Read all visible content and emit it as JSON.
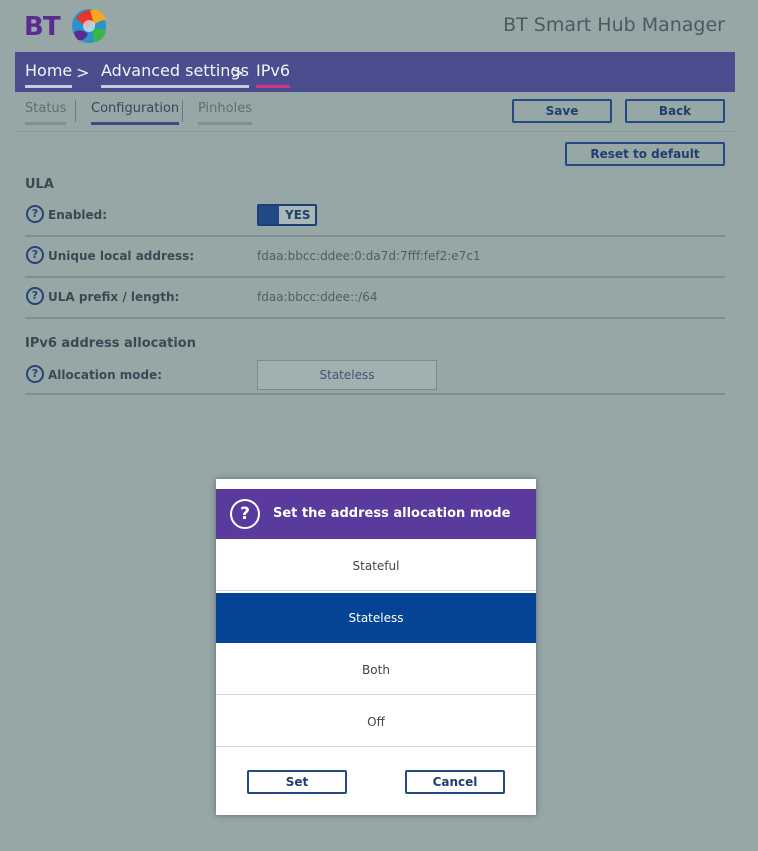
{
  "header": {
    "logo_text": "BT",
    "app_title": "BT Smart Hub Manager"
  },
  "breadcrumb": {
    "items": [
      "Home",
      "Advanced settings",
      "IPv6"
    ],
    "separator": ">"
  },
  "tabs": [
    "Status",
    "Configuration",
    "Pinholes"
  ],
  "toolbar": {
    "save_label": "Save",
    "back_label": "Back",
    "reset_label": "Reset to default"
  },
  "ula": {
    "section_title": "ULA",
    "enabled_label": "Enabled:",
    "enabled_value": "YES",
    "unique_local_address_label": "Unique local address:",
    "unique_local_address_value": "fdaa:bbcc:ddee:0:da7d:7fff:fef2:e7c1",
    "prefix_label": "ULA prefix / length:",
    "prefix_value": "fdaa:bbcc:ddee::/64"
  },
  "allocation": {
    "section_title": "IPv6 address allocation",
    "mode_label": "Allocation mode:",
    "mode_value": "Stateless"
  },
  "modal": {
    "title": "Set the address allocation mode",
    "options": [
      "Stateful",
      "Stateless",
      "Both",
      "Off"
    ],
    "selected": "Stateless",
    "set_label": "Set",
    "cancel_label": "Cancel"
  },
  "colors": {
    "page_background": "#96a7a6",
    "breadcrumb_bar": "#4a4e8e",
    "modal_header": "#5a3a9c",
    "selected_option": "#054495",
    "accent_underline": "#d6347c"
  }
}
